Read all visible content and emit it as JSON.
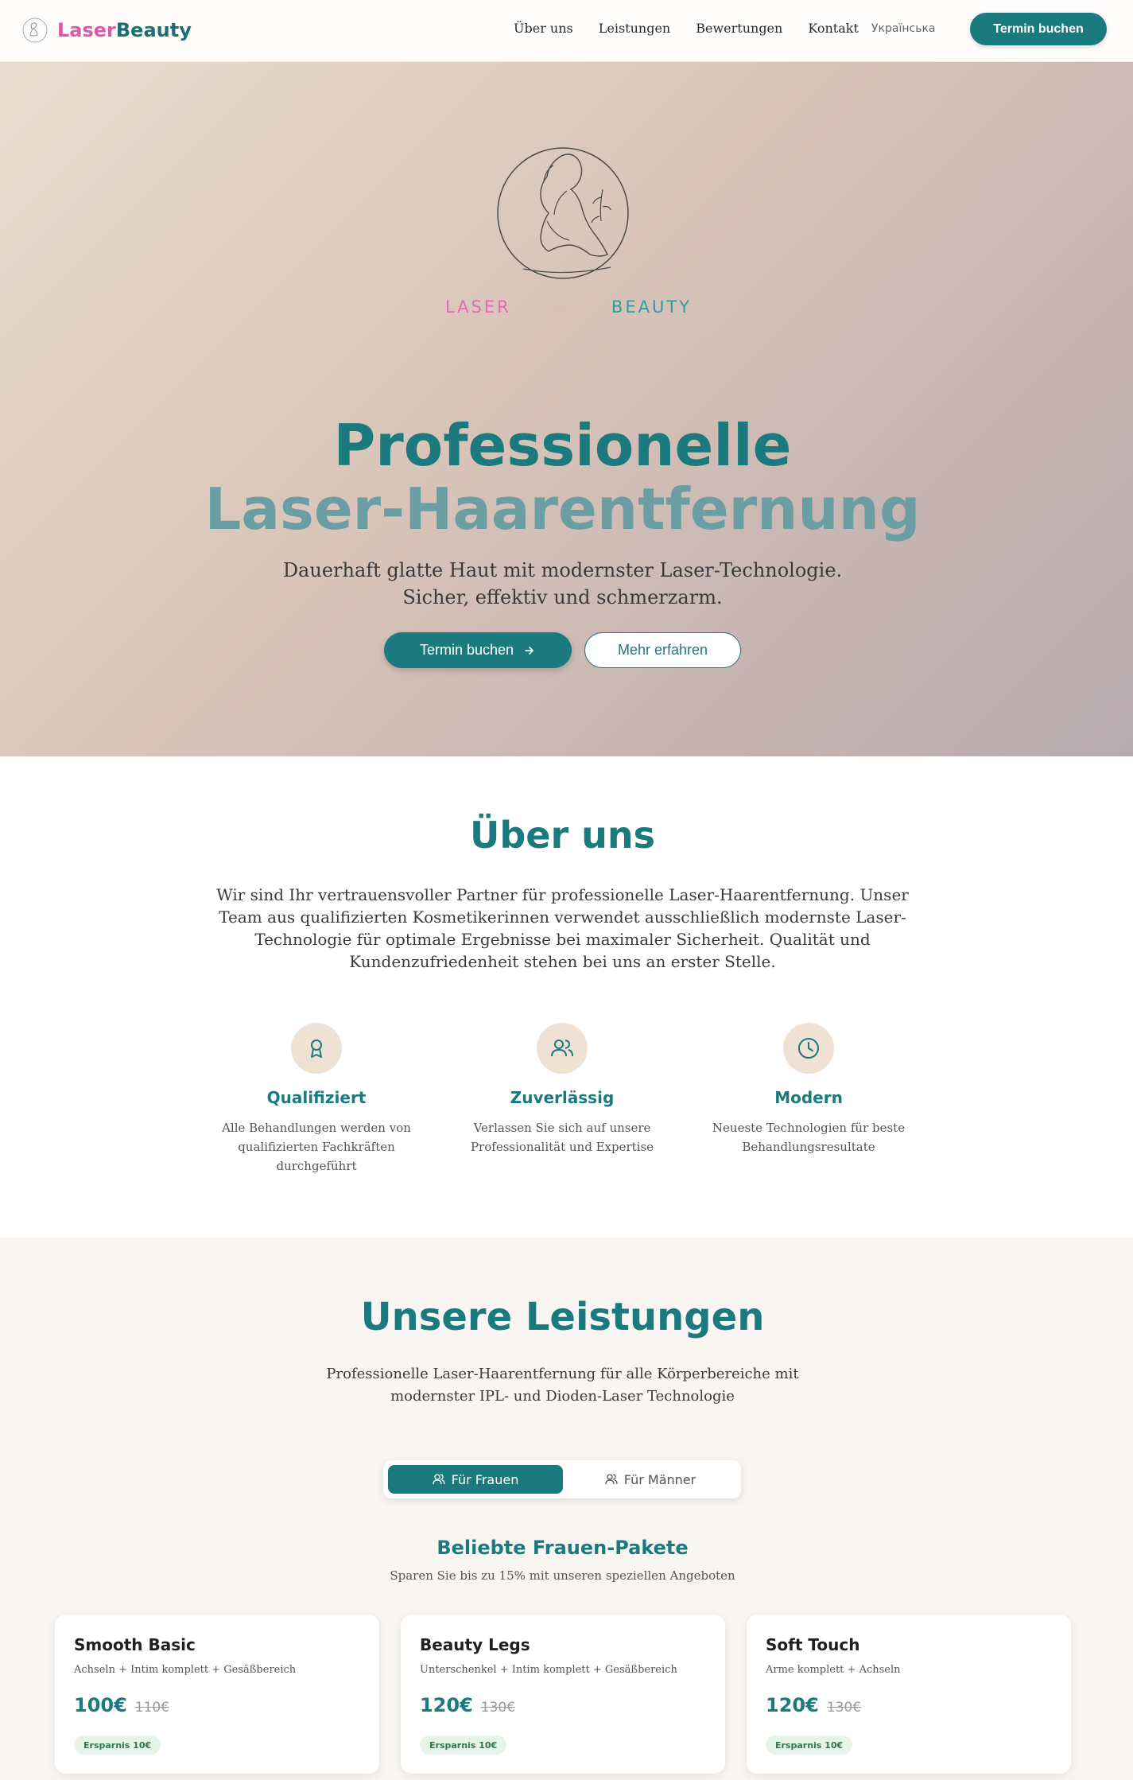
{
  "header": {
    "brand_part1": "Laser",
    "brand_part2": "Beauty",
    "nav": [
      "Über uns",
      "Leistungen",
      "Bewertungen",
      "Kontakt"
    ],
    "language": "Українська",
    "cta": "Termin buchen"
  },
  "hero": {
    "logo_word1": "LASER",
    "logo_word2": "BEAUTY",
    "title_line1": "Professionelle",
    "title_line2": "Laser-Haarentfernung",
    "subtitle_line1": "Dauerhaft glatte Haut mit modernster Laser-Technologie.",
    "subtitle_line2": "Sicher, effektiv und schmerzarm.",
    "primary_button": "Termin buchen",
    "secondary_button": "Mehr erfahren"
  },
  "about": {
    "title": "Über uns",
    "text": "Wir sind Ihr vertrauensvoller Partner für professionelle Laser-Haarentfernung. Unser Team aus qualifizierten Kosmetikerinnen verwendet ausschließlich modernste Laser-Technologie für optimale Ergebnisse bei maximaler Sicherheit. Qualität und Kundenzufriedenheit stehen bei uns an erster Stelle.",
    "features": [
      {
        "title": "Qualifiziert",
        "desc": "Alle Behandlungen werden von qualifizierten Fachkräften durchgeführt",
        "icon": "award-icon"
      },
      {
        "title": "Zuverlässig",
        "desc": "Verlassen Sie sich auf unsere Professionalität und Expertise",
        "icon": "users-icon"
      },
      {
        "title": "Modern",
        "desc": "Neueste Technologien für beste Behandlungsresultate",
        "icon": "clock-icon"
      }
    ]
  },
  "services": {
    "title": "Unsere Leistungen",
    "subtitle": "Professionelle Laser-Haarentfernung für alle Körperbereiche mit modernster IPL- und Dioden-Laser Technologie",
    "tabs": [
      "Für Frauen",
      "Für Männer"
    ],
    "packages_title": "Beliebte Frauen-Pakete",
    "packages_subtitle": "Sparen Sie bis zu 15% mit unseren speziellen Angeboten",
    "packages": [
      {
        "name": "Smooth Basic",
        "desc": "Achseln + Intim komplett + Gesäßbereich",
        "price": "100€",
        "old_price": "110€",
        "badge": "Ersparnis 10€"
      },
      {
        "name": "Beauty Legs",
        "desc": "Unterschenkel + Intim komplett + Gesäßbereich",
        "price": "120€",
        "old_price": "130€",
        "badge": "Ersparnis 10€"
      },
      {
        "name": "Soft Touch",
        "desc": "Arme komplett + Achseln",
        "price": "120€",
        "old_price": "130€",
        "badge": "Ersparnis 10€"
      }
    ]
  },
  "colors": {
    "accent": "#1a7a7d",
    "brand_pink": "#e056a8",
    "muted_teal": "#6a9ea3"
  }
}
